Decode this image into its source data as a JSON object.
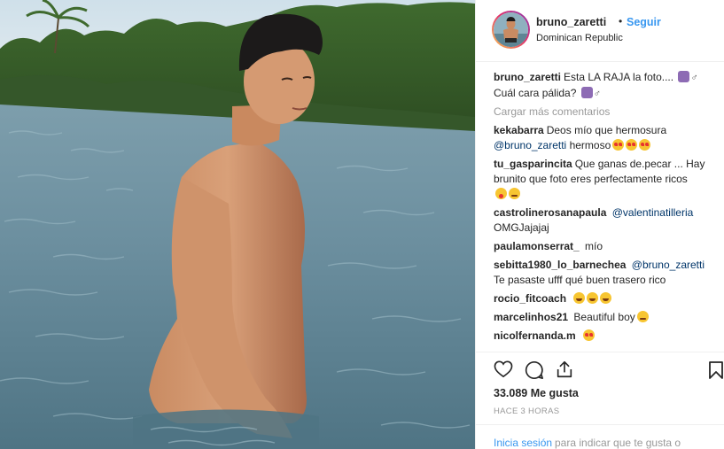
{
  "post": {
    "username": "bruno_zaretti",
    "separator": "•",
    "follow_label": "Seguir",
    "location": "Dominican Republic",
    "photo_icon": "beach-photo"
  },
  "caption": {
    "user": "bruno_zaretti",
    "text": "Esta LA RAJA la foto....",
    "text2": "Cuál cara pálida?"
  },
  "load_more_label": "Cargar más comentarios",
  "comments": [
    {
      "user": "kekabarra",
      "text": "Deos mío que hermosura",
      "mention": "@bruno_zaretti",
      "text2": "hermoso"
    },
    {
      "user": "tu_gasparincita",
      "text": "Que ganas de.pecar ... Hay brunito que foto eres perfectamente ricos"
    },
    {
      "user": "castrolinerosanapaula",
      "mention": "@valentinatilleria",
      "text2": "OMGJajajaj"
    },
    {
      "user": "paulamonserrat_",
      "text": "mío"
    },
    {
      "user": "sebitta1980_lo_barnechea",
      "mention": "@bruno_zaretti",
      "text2": "Te pasaste ufff qué buen trasero rico"
    },
    {
      "user": "rocio_fitcoach",
      "text": ""
    },
    {
      "user": "marcelinhos21",
      "text": "Beautiful boy"
    },
    {
      "user": "nicolfernanda.m",
      "text": ""
    }
  ],
  "actions": {
    "like_icon": "heart-outline-icon",
    "comment_icon": "comment-bubble-icon",
    "share_icon": "share-upload-icon",
    "save_icon": "bookmark-icon"
  },
  "likes": "33.089 Me gusta",
  "time_ago": "HACE 3 HORAS",
  "login": {
    "link": "Inicia sesión",
    "rest": "para indicar que te gusta o"
  },
  "colors": {
    "link_blue": "#3897f0",
    "mention_blue": "#003569",
    "muted": "#999999",
    "text": "#262626"
  }
}
